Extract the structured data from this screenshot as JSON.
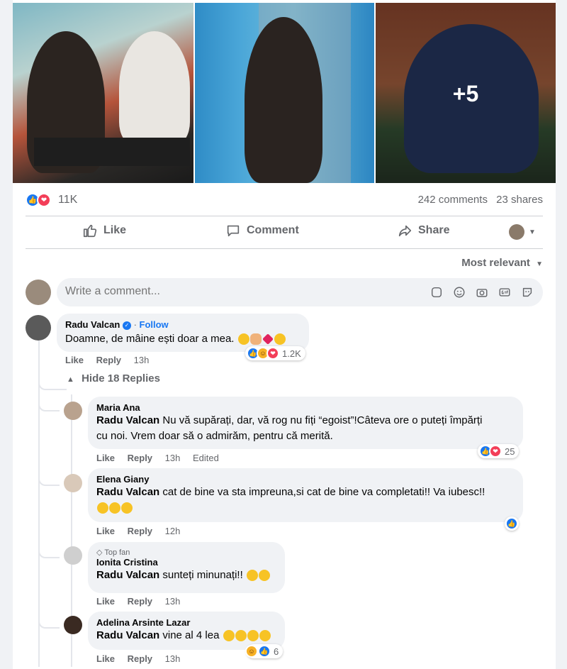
{
  "post": {
    "more_photos": "+5",
    "reaction_count": "11K",
    "comments_count": "242 comments",
    "shares_count": "23 shares"
  },
  "actions": {
    "like": "Like",
    "comment": "Comment",
    "share": "Share"
  },
  "sort_label": "Most relevant",
  "composer": {
    "placeholder": "Write a comment..."
  },
  "comments": [
    {
      "author": "Radu Valcan",
      "follow": "Follow",
      "text": "Doamne, de mâine ești doar a mea.",
      "like": "Like",
      "reply": "Reply",
      "time": "13h",
      "reactions": "1.2K",
      "hide_replies": "Hide 18 Replies"
    }
  ],
  "replies": [
    {
      "author": "Maria Ana",
      "mention": "Radu Valcan",
      "text_line1": "Nu vă supărați, dar, vă rog nu fiți “egoist”!Câteva ore o puteți împărți",
      "text_line2": "cu noi. Vrem doar să o admirăm, pentru că merită.",
      "like": "Like",
      "reply": "Reply",
      "time": "13h",
      "edited": "Edited",
      "reactions": "25"
    },
    {
      "author": "Elena Giany",
      "mention": "Radu Valcan",
      "text": "cat de bine va sta impreuna,si cat de bine va completati!! Va iubesc!!",
      "like": "Like",
      "reply": "Reply",
      "time": "12h"
    },
    {
      "badge": "Top fan",
      "author": "Ionita Cristina",
      "mention": "Radu Valcan",
      "text": "sunteți minunați!!",
      "like": "Like",
      "reply": "Reply",
      "time": "13h"
    },
    {
      "author": "Adelina Arsinte Lazar",
      "mention": "Radu Valcan",
      "text": "vine al 4 lea",
      "like": "Like",
      "reply": "Reply",
      "time": "13h",
      "reactions": "6"
    }
  ],
  "colors": {
    "like_blue": "#1877f2",
    "love_red": "#f33e58",
    "haha_yellow": "#f7b125",
    "bubble_bg": "#f0f2f5",
    "muted_text": "#65676b"
  }
}
